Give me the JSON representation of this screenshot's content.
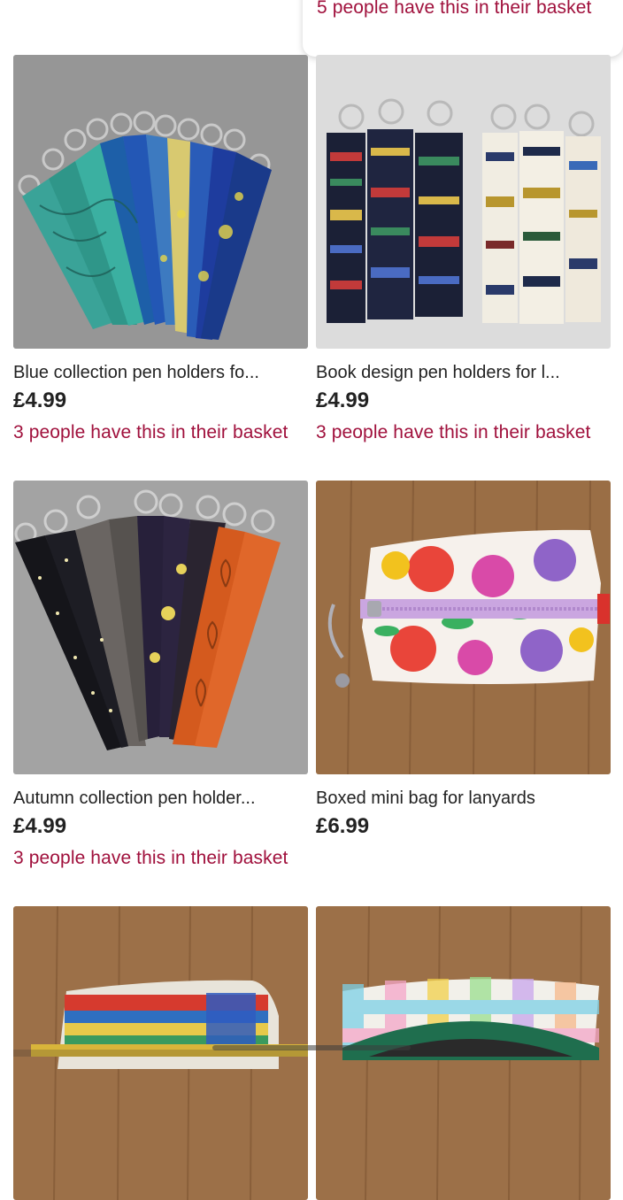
{
  "top_note": "5 people have this in their basket",
  "listings": [
    {
      "title": "Blue collection pen holders fo...",
      "price": "£4.99",
      "basket_note": "3 people have this in their basket"
    },
    {
      "title": "Book design pen holders for l...",
      "price": "£4.99",
      "basket_note": "3 people have this in their basket"
    },
    {
      "title": "Autumn collection pen holder...",
      "price": "£4.99",
      "basket_note": "3 people have this in their basket"
    },
    {
      "title": "Boxed mini bag for lanyards",
      "price": "£6.99",
      "basket_note": ""
    }
  ],
  "colors": {
    "basket_text": "#a0103c",
    "text": "#222222"
  }
}
